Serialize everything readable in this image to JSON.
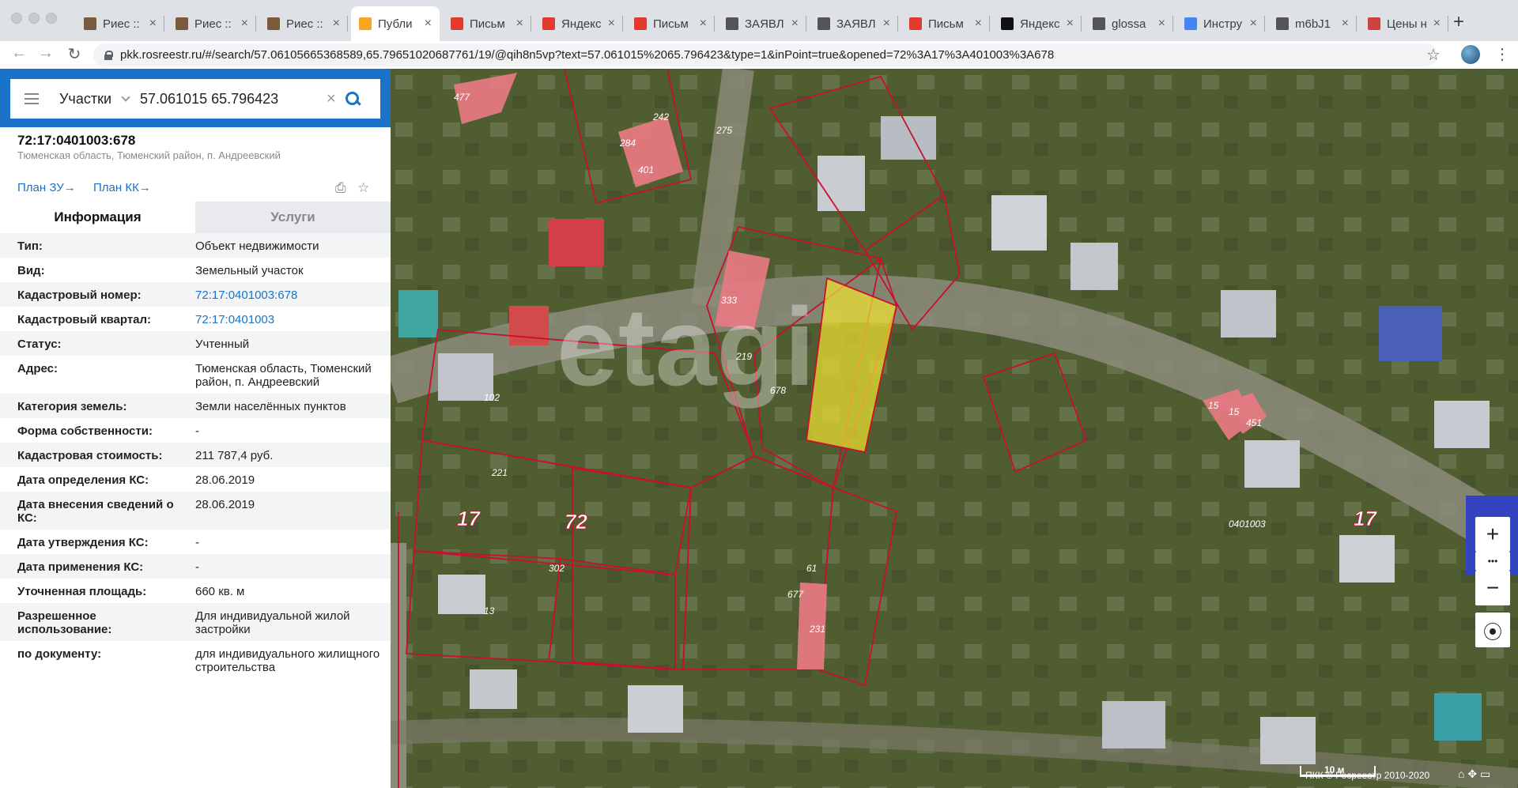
{
  "browser": {
    "tabs": [
      {
        "label": "Риес ::",
        "icon": "document-icon",
        "color": "#7a5c3b"
      },
      {
        "label": "Риес ::",
        "icon": "document-icon",
        "color": "#7a5c3b"
      },
      {
        "label": "Риес ::",
        "icon": "document-icon",
        "color": "#7a5c3b"
      },
      {
        "label": "Публи",
        "icon": "pkk-icon",
        "color": "#f5a623",
        "active": true
      },
      {
        "label": "Письм",
        "icon": "mail-icon",
        "color": "#e23a2f"
      },
      {
        "label": "Яндекс",
        "icon": "mail-icon",
        "color": "#e23a2f"
      },
      {
        "label": "Письм",
        "icon": "mail-icon",
        "color": "#e23a2f"
      },
      {
        "label": "ЗАЯВЛ",
        "icon": "globe-icon",
        "color": "#555555"
      },
      {
        "label": "ЗАЯВЛ",
        "icon": "globe-icon",
        "color": "#555555"
      },
      {
        "label": "Письм",
        "icon": "mail-icon",
        "color": "#e23a2f"
      },
      {
        "label": "Яндекс",
        "icon": "yandex-icon",
        "color": "#111111"
      },
      {
        "label": "glossa",
        "icon": "globe-icon",
        "color": "#555555"
      },
      {
        "label": "Инстру",
        "icon": "docs-icon",
        "color": "#4285f4"
      },
      {
        "label": "m6bJ1",
        "icon": "globe-icon",
        "color": "#555555"
      },
      {
        "label": "Цены н",
        "icon": "shop-icon",
        "color": "#d04040"
      }
    ],
    "close_glyph": "×",
    "new_tab_glyph": "+",
    "back_glyph": "←",
    "forward_glyph": "→",
    "reload_glyph": "↻",
    "url": "pkk.rosreestr.ru/#/search/57.06105665368589,65.79651020687761/19/@qih8n5vp?text=57.061015%2065.796423&type=1&inPoint=true&opened=72%3A17%3A401003%3A678",
    "star_glyph": "☆",
    "menu_glyph": "⋮"
  },
  "search": {
    "category": "Участки",
    "query": "57.061015 65.796423",
    "clear_glyph": "×",
    "collapse_glyph": "‹"
  },
  "object": {
    "cadastral_number": "72:17:0401003:678",
    "address": "Тюменская область, Тюменский район, п. Андреевский",
    "plan_zu": "План ЗУ→",
    "plan_kk": "План КК→",
    "print_glyph": "⎙",
    "favorite_glyph": "☆"
  },
  "tabs": {
    "info": "Информация",
    "services": "Услуги"
  },
  "info_rows": [
    {
      "key": "Тип:",
      "value": "Объект недвижимости"
    },
    {
      "key": "Вид:",
      "value": "Земельный участок"
    },
    {
      "key": "Кадастровый номер:",
      "value": "72:17:0401003:678",
      "link": true
    },
    {
      "key": "Кадастровый квартал:",
      "value": "72:17:0401003",
      "link": true
    },
    {
      "key": "Статус:",
      "value": "Учтенный"
    },
    {
      "key": "Адрес:",
      "value": "Тюменская область, Тюменский район, п. Андреевский"
    },
    {
      "key": "Категория земель:",
      "value": "Земли населённых пунктов"
    },
    {
      "key": "Форма собственности:",
      "value": "-"
    },
    {
      "key": "Кадастровая стоимость:",
      "value": "211 787,4 руб."
    },
    {
      "key": "Дата определения КС:",
      "value": "28.06.2019"
    },
    {
      "key": "Дата внесения сведений о КС:",
      "value": "28.06.2019"
    },
    {
      "key": "Дата утверждения КС:",
      "value": "-"
    },
    {
      "key": "Дата применения КС:",
      "value": "-"
    },
    {
      "key": "Уточненная площадь:",
      "value": "660 кв. м"
    },
    {
      "key": "Разрешенное использование:",
      "value": "Для индивидуальной жилой застройки"
    },
    {
      "key": "по документу:",
      "value": "для индивидуального жилищного строительства"
    }
  ],
  "map": {
    "watermark": "etagi",
    "parcel_labels": [
      {
        "text": "477"
      },
      {
        "text": "284"
      },
      {
        "text": "401"
      },
      {
        "text": "242"
      },
      {
        "text": "275"
      },
      {
        "text": "333"
      },
      {
        "text": "219"
      },
      {
        "text": "678"
      },
      {
        "text": "102"
      },
      {
        "text": "15"
      },
      {
        "text": "15"
      },
      {
        "text": "451"
      },
      {
        "text": "221"
      },
      {
        "text": "302"
      },
      {
        "text": "61"
      },
      {
        "text": "677"
      },
      {
        "text": "231"
      },
      {
        "text": "13"
      },
      {
        "text": "0401003"
      }
    ],
    "block_labels": [
      {
        "text": "17"
      },
      {
        "text": "72"
      },
      {
        "text": "17"
      }
    ],
    "zoom_in_glyph": "+",
    "more_glyph": "•••",
    "zoom_out_glyph": "−",
    "compass_glyph": "⦿",
    "scale": "10 м",
    "copyright": "ПКК © Росреестр 2010-2020",
    "corner_glyphs": "⌂ ✥ ▭",
    "colors": {
      "selected_parcel": "#f2e531",
      "building": "#e87a82",
      "boundary": "#c8102e"
    }
  }
}
